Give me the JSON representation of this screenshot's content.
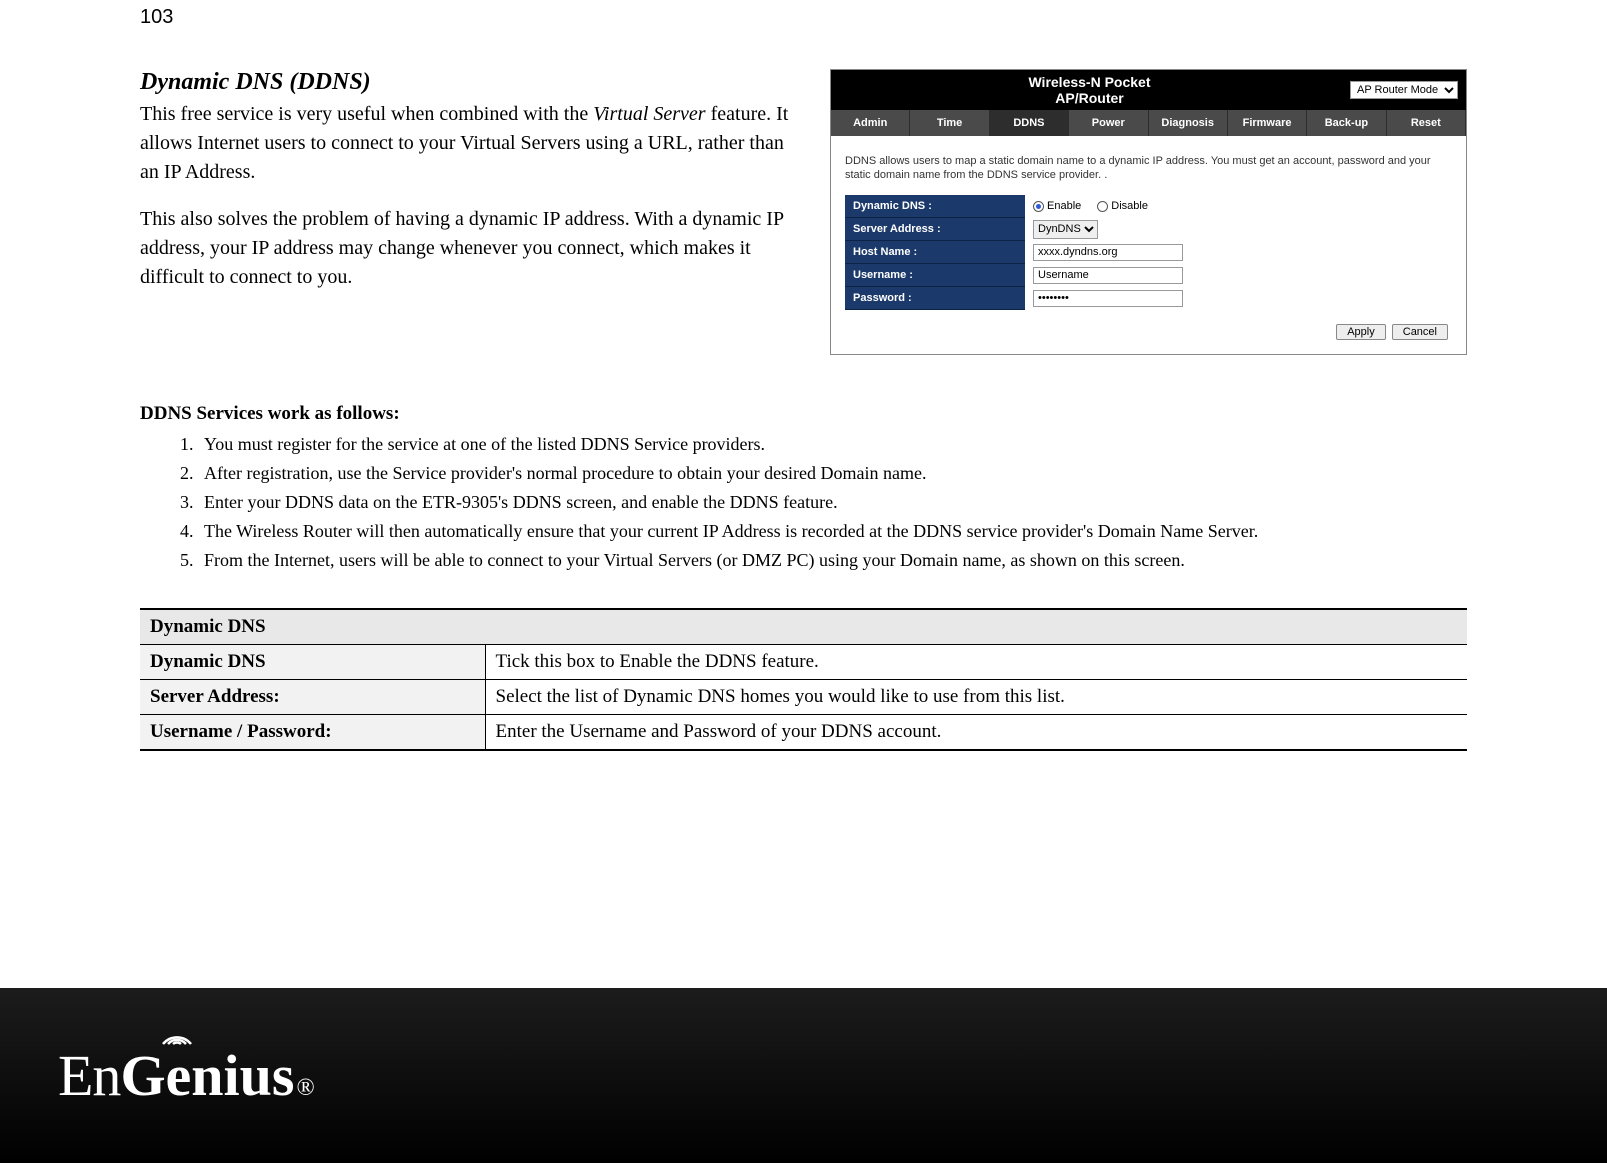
{
  "page_number": "103",
  "section_title": "Dynamic DNS (DDNS)",
  "intro": {
    "p1_a": "This free service is very useful when combined with the ",
    "p1_i1": "Virtual Server",
    "p1_b": " feature. It allows Internet users to connect to your Virtual Servers using a URL, rather than an IP Address.",
    "p2": "This also solves the problem of having a dynamic IP address. With a dynamic IP address, your IP address may change whenever you connect, which makes it difficult to connect to you."
  },
  "steps_heading": "DDNS Services work as follows:",
  "steps": [
    "You must register for the service at one of the listed DDNS Service providers.",
    "After registration, use the Service provider's normal procedure to obtain your desired Domain name.",
    "Enter your DDNS data on the ETR-9305's DDNS screen, and enable the DDNS feature.",
    "The Wireless Router will then automatically ensure that your current IP Address is recorded at the DDNS service provider's Domain Name Server.",
    "From the Internet, users will be able to connect to your Virtual Servers (or DMZ PC) using your Domain name, as shown on this screen."
  ],
  "router": {
    "title": "Wireless-N Pocket AP/Router",
    "mode_selected": "AP Router Mode",
    "tabs": [
      "Admin",
      "Time",
      "DDNS",
      "Power",
      "Diagnosis",
      "Firmware",
      "Back-up",
      "Reset"
    ],
    "active_tab": "DDNS",
    "desc": "DDNS allows users to map a static domain name to a dynamic IP address. You must get an account, password and your static domain name from the DDNS service provider. .",
    "rows": {
      "ddns_label": "Dynamic DNS :",
      "ddns_enable": "Enable",
      "ddns_disable": "Disable",
      "server_label": "Server Address :",
      "server_value": "DynDNS",
      "host_label": "Host Name :",
      "host_value": "xxxx.dyndns.org",
      "user_label": "Username :",
      "user_placeholder": "Username",
      "pass_label": "Password :",
      "pass_value": "••••••••"
    },
    "apply": "Apply",
    "cancel": "Cancel"
  },
  "settings_table": {
    "header": "Dynamic DNS",
    "rows": [
      {
        "k": "Dynamic DNS",
        "v": "Tick this box to Enable the DDNS feature."
      },
      {
        "k": "Server Address:",
        "v": "Select the list of Dynamic DNS homes you would like to use from this list."
      },
      {
        "k": "Username / Password:",
        "v": "Enter the Username and Password of your DDNS account."
      }
    ]
  },
  "brand": {
    "en": "En",
    "gen": "Genius",
    "reg": "®"
  }
}
